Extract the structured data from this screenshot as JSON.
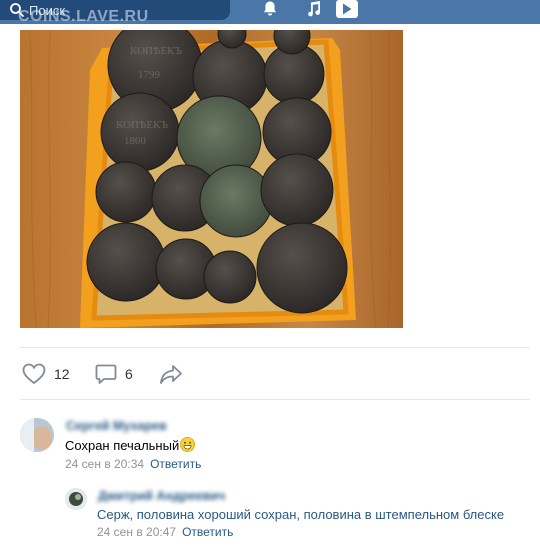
{
  "header": {
    "search_placeholder": "Поиск",
    "watermark": "COINS.LAVE.RU",
    "icons": [
      "search-icon",
      "bell-icon",
      "music-icon",
      "video-play-icon"
    ]
  },
  "post": {
    "photo_alt": "coins-in-box",
    "likes": "12",
    "comments": "6"
  },
  "comments": [
    {
      "author": "Сергей Мухарев",
      "text": "Сохран печальный",
      "emoji": "grinning-face",
      "date": "24 сен в 20:34",
      "reply_label": "Ответить"
    },
    {
      "author": "Дмитрий Андреевич",
      "text": "Серж, половина хороший сохран, половина в штемпельном блеске",
      "date": "24 сен в 20:47",
      "reply_label": "Ответить"
    }
  ],
  "colors": {
    "header_bg": "#4a76a8",
    "search_bg": "#224b7a",
    "link": "#2a5885",
    "meta": "#939393",
    "box_orange": "#f5a623"
  }
}
